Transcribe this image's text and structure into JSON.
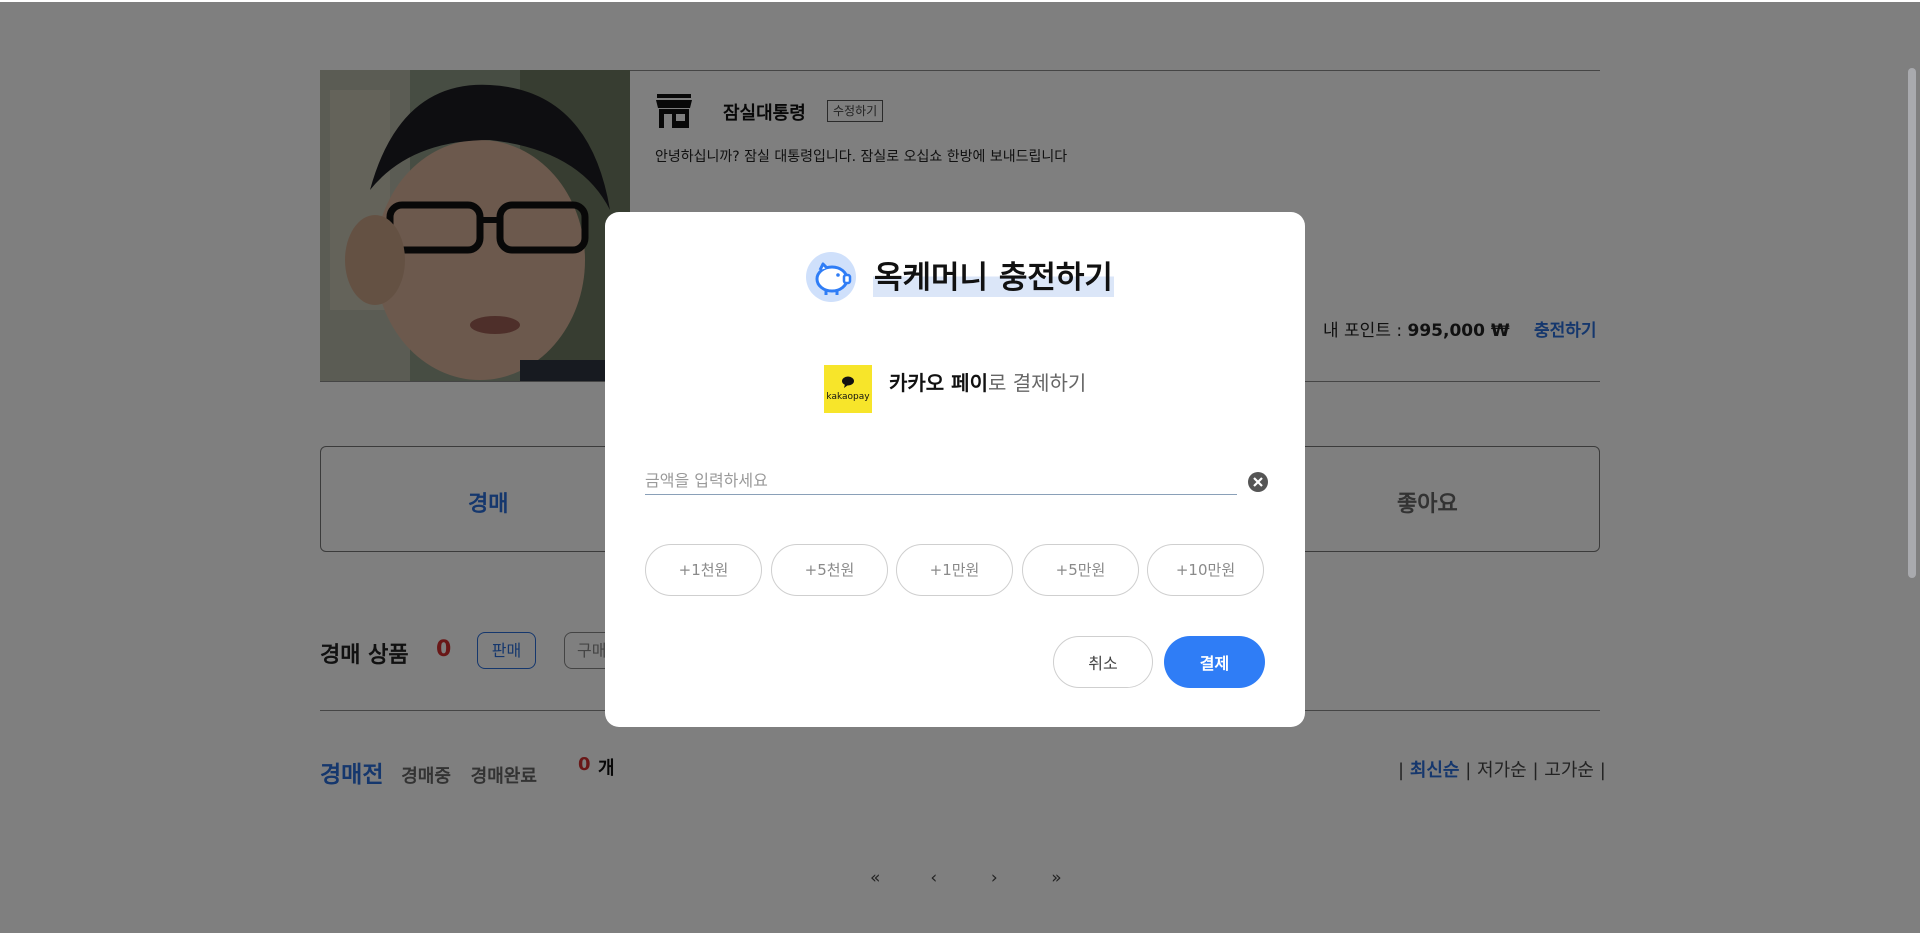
{
  "profile": {
    "shop_name": "잠실대통령",
    "edit_label": "수정하기",
    "intro": "안녕하십니까? 잠실 대통령입니다. 잠실로 오십쇼 한방에 보내드립니다"
  },
  "points": {
    "label": "내 포인트 : ",
    "value": "995,000 ₩",
    "charge_label": "충전하기"
  },
  "tabs": {
    "auction": "경매",
    "like": "좋아요"
  },
  "section": {
    "title": "경매 상품",
    "count": "0",
    "sell_label": "판매",
    "buy_label_partial": "구매"
  },
  "status_tabs": {
    "active": "경매전",
    "in_progress": "경매중",
    "done": "경매완료",
    "count": "0",
    "unit": "개"
  },
  "sort": {
    "sep": "|",
    "latest": "최신순",
    "low": "저가순",
    "high": "고가순"
  },
  "pager": {
    "first": "«",
    "prev": "‹",
    "next": "›",
    "last": "»"
  },
  "modal": {
    "title": "옥케머니 충전하기",
    "pay_method_bold": "카카오 페이",
    "pay_method_rest": "로 결제하기",
    "amount_placeholder": "금액을 입력하세요",
    "amount_value": "",
    "quick_amounts": [
      "+1천원",
      "+5천원",
      "+1만원",
      "+5만원",
      "+10만원"
    ],
    "cancel_label": "취소",
    "pay_label": "결제",
    "kakao_logo_text": "kakaopay"
  },
  "colors": {
    "accent": "#2a6edb",
    "pay_button": "#2f7df6",
    "count_red": "#d32f2f",
    "kakao_yellow": "#f7e52a",
    "overlay": "rgba(0,0,0,0.5)"
  }
}
